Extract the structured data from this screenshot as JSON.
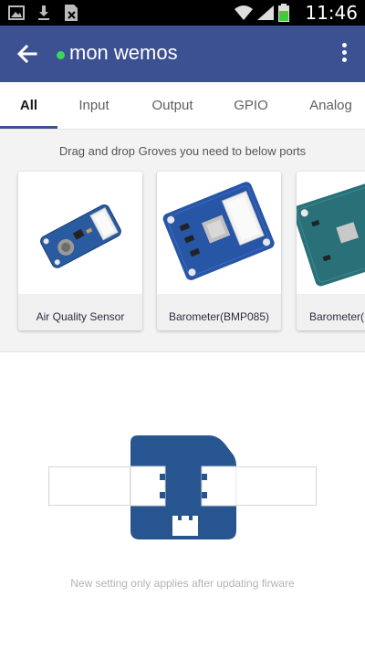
{
  "status_bar": {
    "time": "11:46",
    "icons": [
      "gallery-icon",
      "download-icon",
      "no-sim-icon",
      "wifi-icon",
      "signal-icon",
      "battery-icon"
    ]
  },
  "app_bar": {
    "title": "mon wemos",
    "status": "online",
    "color": "#3b5192",
    "status_color": "#3fd55c"
  },
  "tabs": [
    {
      "label": "All",
      "active": true
    },
    {
      "label": "Input",
      "active": false
    },
    {
      "label": "Output",
      "active": false
    },
    {
      "label": "GPIO",
      "active": false
    },
    {
      "label": "Analog",
      "active": false
    }
  ],
  "groves": {
    "hint": "Drag and drop Groves you need to below ports",
    "cards": [
      {
        "label": "Air Quality Sensor",
        "icon": "air-quality-sensor-board"
      },
      {
        "label": "Barometer(BMP085)",
        "icon": "barometer-bmp085-board"
      },
      {
        "label": "Barometer(B",
        "icon": "barometer-board"
      }
    ]
  },
  "board": {
    "icon": "wemos-board-icon",
    "color": "#27558f",
    "note": "New setting only applies after updating firware"
  }
}
